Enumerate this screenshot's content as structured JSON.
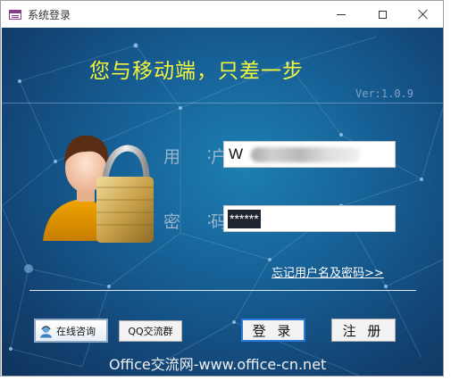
{
  "window": {
    "title": "系统登录",
    "controls": {
      "minimize": "minimize",
      "maximize": "maximize",
      "close": "close"
    }
  },
  "header": {
    "slogan": "您与移动端，只差一步",
    "version": "Ver:1.0.9"
  },
  "form": {
    "username_label": "用 户",
    "password_label": "密 码",
    "colon": ":",
    "username_value": "W",
    "password_value": "******",
    "forgot_link": "忘记用户名及密码>>"
  },
  "buttons": {
    "consult": "在线咨询",
    "qq_group": "QQ交流群",
    "login": "登 录",
    "register": "注 册"
  },
  "footer": {
    "watermark": "Office交流网-www.office-cn.net"
  },
  "colors": {
    "background": "#165f95",
    "slogan": "#f5f53a",
    "label": "#9bb4d0",
    "login_border": "#2b7ad6"
  },
  "icons": [
    "app-icon",
    "minimize-icon",
    "maximize-icon",
    "close-icon",
    "user-avatar-icon",
    "padlock-icon",
    "consult-icon"
  ]
}
